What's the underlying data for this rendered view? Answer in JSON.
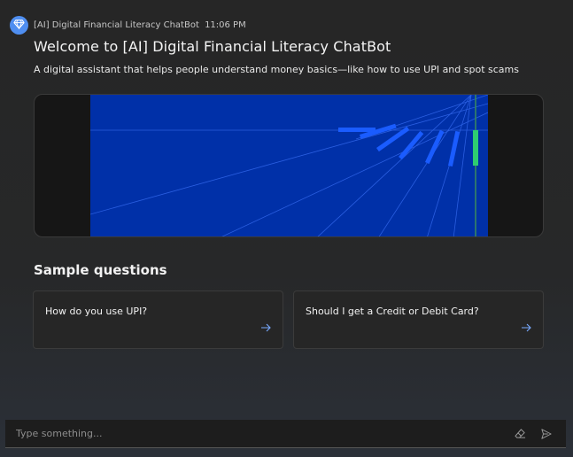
{
  "header": {
    "bot_name": "[AI] Digital Financial Literacy ChatBot",
    "time": "11:06 PM",
    "avatar_icon": "diamond-icon"
  },
  "welcome": {
    "title": "Welcome to [AI] Digital Financial Literacy ChatBot",
    "subtitle": "A digital assistant that helps people understand money basics—like how to use UPI and spot scams"
  },
  "hero": {
    "background_color": "#0030a8",
    "bar_color": "#1a5cff",
    "accent_color": "#2ecc71"
  },
  "samples": {
    "title": "Sample questions",
    "items": [
      {
        "label": "How do you use UPI?",
        "icon": "arrow-right-icon"
      },
      {
        "label": "Should I get a Credit or Debit Card?",
        "icon": "arrow-right-icon"
      }
    ]
  },
  "composer": {
    "placeholder": "Type something...",
    "clear_icon": "eraser-icon",
    "send_icon": "send-icon"
  }
}
